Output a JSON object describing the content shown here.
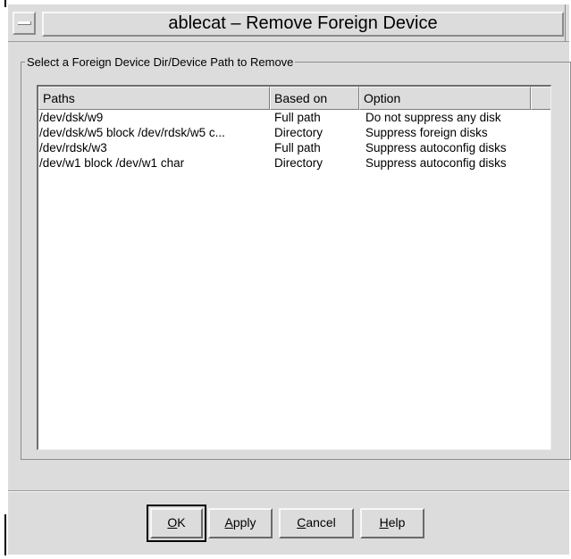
{
  "window": {
    "title": "ablecat – Remove Foreign Device"
  },
  "group": {
    "label": "Select a Foreign Device Dir/Device Path to Remove"
  },
  "table": {
    "columns": [
      "Paths",
      "Based on",
      "Option"
    ],
    "rows": [
      [
        "/dev/dsk/w9",
        "Full path",
        "Do not suppress any disk"
      ],
      [
        "/dev/dsk/w5  block  /dev/rdsk/w5  c...",
        "Directory",
        "Suppress foreign disks"
      ],
      [
        "/dev/rdsk/w3",
        "Full path",
        "Suppress autoconfig disks"
      ],
      [
        "/dev/w1  block  /dev/w1  char",
        "Directory",
        "Suppress autoconfig disks"
      ]
    ]
  },
  "buttons": {
    "ok": {
      "mnemonic": "O",
      "rest": "K"
    },
    "apply": {
      "mnemonic": "A",
      "rest": "pply"
    },
    "cancel": {
      "mnemonic": "C",
      "rest": "ancel"
    },
    "help": {
      "mnemonic": "H",
      "rest": "elp"
    }
  }
}
